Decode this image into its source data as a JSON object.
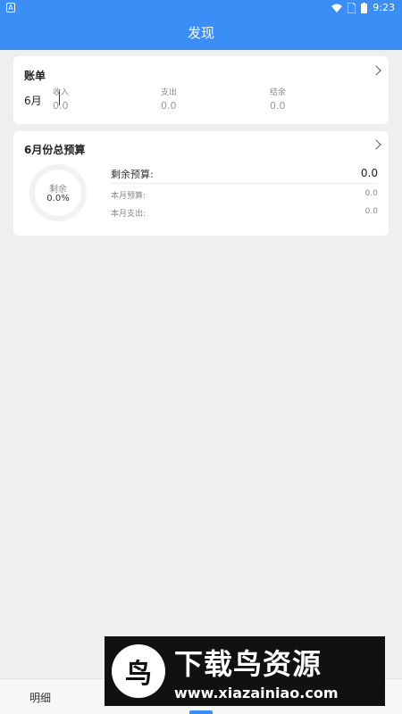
{
  "statusbar": {
    "app_badge": "A",
    "time": "9:23"
  },
  "header": {
    "title": "发现"
  },
  "bill": {
    "title": "账单",
    "month": "6月",
    "columns": [
      {
        "label": "收入",
        "value": "0.0"
      },
      {
        "label": "支出",
        "value": "0.0"
      },
      {
        "label": "结余",
        "value": "0.0"
      }
    ]
  },
  "budget": {
    "title": "6月份总预算",
    "ring_label": "剩余",
    "ring_value": "0.0%",
    "remaining_label": "剩余预算:",
    "remaining_value": "0.0",
    "month_budget_label": "本月预算:",
    "month_budget_value": "0.0",
    "month_spend_label": "本月支出:",
    "month_spend_value": "0.0"
  },
  "bottom_nav": {
    "item1": "明细"
  },
  "watermark": {
    "logo_char": "鸟",
    "title": "下载鸟资源",
    "url": "www.xiazainiao.com"
  }
}
